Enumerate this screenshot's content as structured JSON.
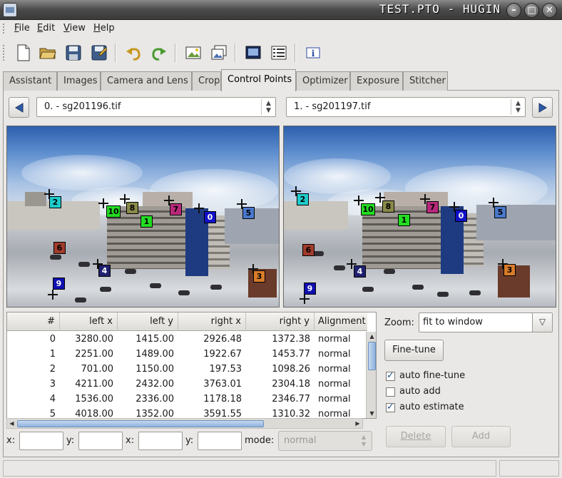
{
  "window": {
    "title": "TEST.PTO - HUGIN"
  },
  "menu": [
    {
      "label": "File",
      "mnemonic": "F",
      "rest": "ile"
    },
    {
      "label": "Edit",
      "mnemonic": "E",
      "rest": "dit"
    },
    {
      "label": "View",
      "mnemonic": "V",
      "rest": "iew"
    },
    {
      "label": "Help",
      "mnemonic": "H",
      "rest": "elp"
    }
  ],
  "toolbar_icons": [
    "new-file-icon",
    "open-folder-icon",
    "save-icon",
    "save-as-icon",
    "undo-icon",
    "redo-icon",
    "add-images-icon",
    "add-time-series-icon",
    "preview-icon",
    "control-point-list-icon",
    "about-icon"
  ],
  "tabs": [
    "Assistant",
    "Images",
    "Camera and Lens",
    "Crop",
    "Control Points",
    "Optimizer",
    "Exposure",
    "Stitcher"
  ],
  "active_tab": "Control Points",
  "left_image": {
    "label": "0. - sg201196.tif"
  },
  "right_image": {
    "label": "1. - sg201197.tif"
  },
  "control_point_markers": {
    "left": [
      "0",
      "1",
      "2",
      "3",
      "4",
      "5",
      "6",
      "7",
      "8",
      "9",
      "10"
    ],
    "right": [
      "0",
      "1",
      "2",
      "3",
      "4",
      "5",
      "6",
      "7",
      "8",
      "9",
      "10"
    ]
  },
  "marker_colors": {
    "0": "#1010c8",
    "1": "#22dd22",
    "2": "#1ecccc",
    "3": "#d87c2a",
    "4": "#202070",
    "5": "#4a78cc",
    "6": "#a03c2c",
    "7": "#b8287a",
    "8": "#8a8a4a",
    "9": "#1010b0",
    "10": "#22dd22"
  },
  "table": {
    "columns": [
      "#",
      "left x",
      "left y",
      "right x",
      "right y",
      "Alignment"
    ],
    "rows": [
      [
        "0",
        "3280.00",
        "1415.00",
        "2926.48",
        "1372.38",
        "normal"
      ],
      [
        "1",
        "2251.00",
        "1489.00",
        "1922.67",
        "1453.77",
        "normal"
      ],
      [
        "2",
        "701.00",
        "1150.00",
        "197.53",
        "1098.26",
        "normal"
      ],
      [
        "3",
        "4211.00",
        "2432.00",
        "3763.01",
        "2304.18",
        "normal"
      ],
      [
        "4",
        "1536.00",
        "2336.00",
        "1178.18",
        "2346.77",
        "normal"
      ],
      [
        "5",
        "4018.00",
        "1352.00",
        "3591.55",
        "1310.32",
        "normal"
      ]
    ]
  },
  "edit_row": {
    "x_label": "x:",
    "y_label": "y:",
    "x2_label": "x:",
    "y2_label": "y:",
    "mode_label": "mode:",
    "mode_value": "normal"
  },
  "zoom": {
    "label": "Zoom:",
    "value": "fit to window"
  },
  "buttons": {
    "fine_tune": "Fine-tune",
    "delete": "Delete",
    "add": "Add"
  },
  "options": [
    {
      "label": "auto fine-tune",
      "checked": true
    },
    {
      "label": "auto add",
      "checked": false
    },
    {
      "label": "auto estimate",
      "checked": true
    }
  ]
}
